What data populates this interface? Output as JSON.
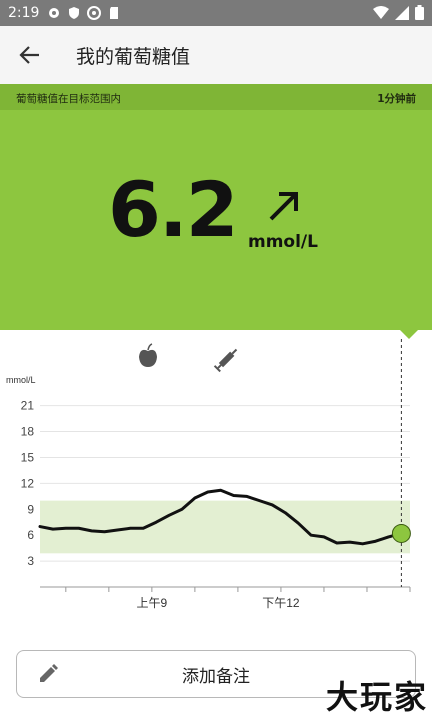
{
  "status_bar": {
    "time": "2:19",
    "icons": [
      "settings-icon",
      "shield-icon",
      "vpn-icon",
      "sd-card-icon",
      "wifi-icon",
      "signal-icon",
      "battery-icon"
    ]
  },
  "app_bar": {
    "title": "我的葡萄糖值",
    "back_icon": "back-arrow-icon"
  },
  "status_banner": {
    "message": "葡萄糖值在目标范围内",
    "age": "1分钟前"
  },
  "reading": {
    "value": "6.2",
    "unit": "mmol/L",
    "trend": "rising-diagonal"
  },
  "markers": {
    "food_icon": "apple-icon",
    "insulin_icon": "syringe-icon"
  },
  "chart_data": {
    "type": "line",
    "ylabel": "mmol/L",
    "yticks": [
      3,
      6,
      9,
      12,
      15,
      18,
      21
    ],
    "ylim": [
      0,
      22
    ],
    "target_range": [
      3.9,
      10.0
    ],
    "xticks": [
      {
        "label": "上午9",
        "hour": 9
      },
      {
        "label": "下午12",
        "hour": 12
      }
    ],
    "xlim": [
      6.4,
      15.0
    ],
    "series": [
      {
        "x": [
          6.4,
          6.7,
          7.0,
          7.3,
          7.6,
          7.9,
          8.2,
          8.5,
          8.8,
          9.1,
          9.4,
          9.7,
          10.0,
          10.3,
          10.6,
          10.9,
          11.2,
          11.5,
          11.8,
          12.1,
          12.4,
          12.7,
          13.0,
          13.3,
          13.6,
          13.9,
          14.2,
          14.5,
          14.8
        ],
        "y": [
          7.0,
          6.7,
          6.8,
          6.8,
          6.5,
          6.4,
          6.6,
          6.8,
          6.8,
          7.5,
          8.3,
          9.0,
          10.3,
          11.0,
          11.2,
          10.6,
          10.5,
          10.0,
          9.5,
          8.6,
          7.4,
          6.0,
          5.8,
          5.1,
          5.2,
          5.0,
          5.3,
          5.8,
          6.2
        ]
      }
    ],
    "current_value": 6.2,
    "colors": {
      "line": "#111111",
      "target_band": "#e3efd2",
      "current_dot": "#8dc63f"
    }
  },
  "add_note": {
    "label": "添加备注",
    "icon": "pencil-icon"
  },
  "watermark": "大玩家",
  "colors": {
    "accent": "#8dc63f",
    "banner": "#7fb536"
  }
}
